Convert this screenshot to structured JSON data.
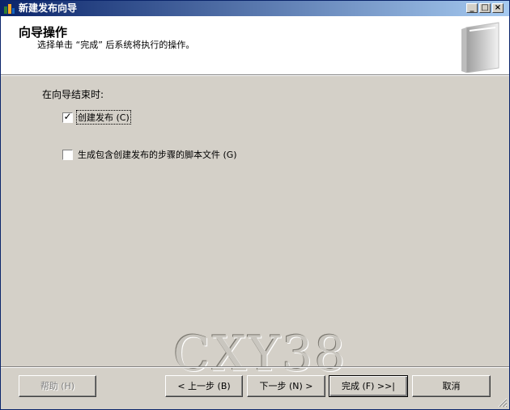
{
  "window": {
    "title": "新建发布向导",
    "controls": [
      "_",
      "□",
      "×"
    ]
  },
  "header": {
    "title": "向导操作",
    "subtitle": "选择单击 “完成” 后系统将执行的操作。"
  },
  "content": {
    "group_label": "在向导结束时:",
    "options": [
      {
        "label": "创建发布 (C)",
        "checked": true,
        "check_glyph": "✓"
      },
      {
        "label": "生成包含创建发布的步骤的脚本文件 (G)",
        "checked": false,
        "check_glyph": ""
      }
    ]
  },
  "watermark": "CXY38",
  "buttons": {
    "help": "帮助 (H)",
    "back": "< 上一步 (B)",
    "next": "下一步 (N) >",
    "finish": "完成 (F) >>|",
    "cancel": "取消"
  }
}
